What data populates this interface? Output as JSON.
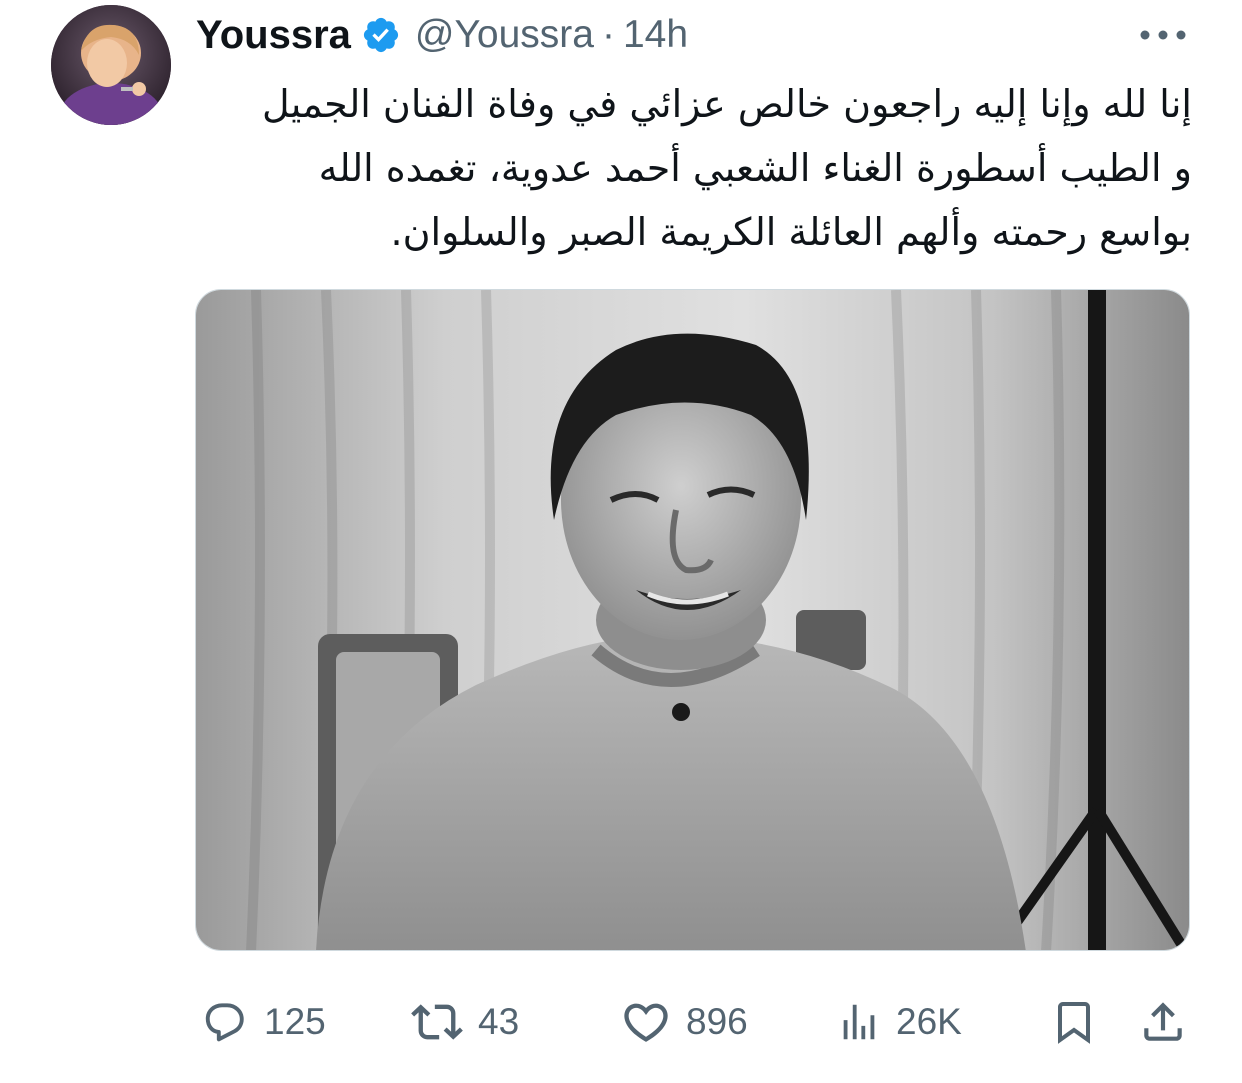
{
  "tweet": {
    "author": {
      "display_name": "Youssra",
      "handle": "@Youssra",
      "verified": true,
      "avatar_icon": "profile-photo"
    },
    "separator": "·",
    "time": "14h",
    "text_lines": [
      "إنا لله وإنا إليه راجعون خالص عزائي في وفاة الفنان الجميل",
      "و الطيب أسطورة الغناء الشعبي أحمد عدوية، تغمده الله",
      "بواسع رحمته وألهم العائلة الكريمة الصبر والسلوان."
    ],
    "media": {
      "kind": "photo",
      "style": "black-and-white portrait"
    },
    "actions": {
      "replies": "125",
      "reposts": "43",
      "likes": "896",
      "views": "26K"
    }
  },
  "icons": {
    "verified": "verified-badge-icon",
    "more": "more-options-icon",
    "reply": "reply-icon",
    "repost": "repost-icon",
    "like": "like-icon",
    "views": "views-icon",
    "bookmark": "bookmark-icon",
    "share": "share-icon"
  },
  "colors": {
    "text_primary": "#0f1419",
    "text_secondary": "#536471",
    "verified_blue": "#1d9bf0",
    "border": "#cfd9de"
  }
}
